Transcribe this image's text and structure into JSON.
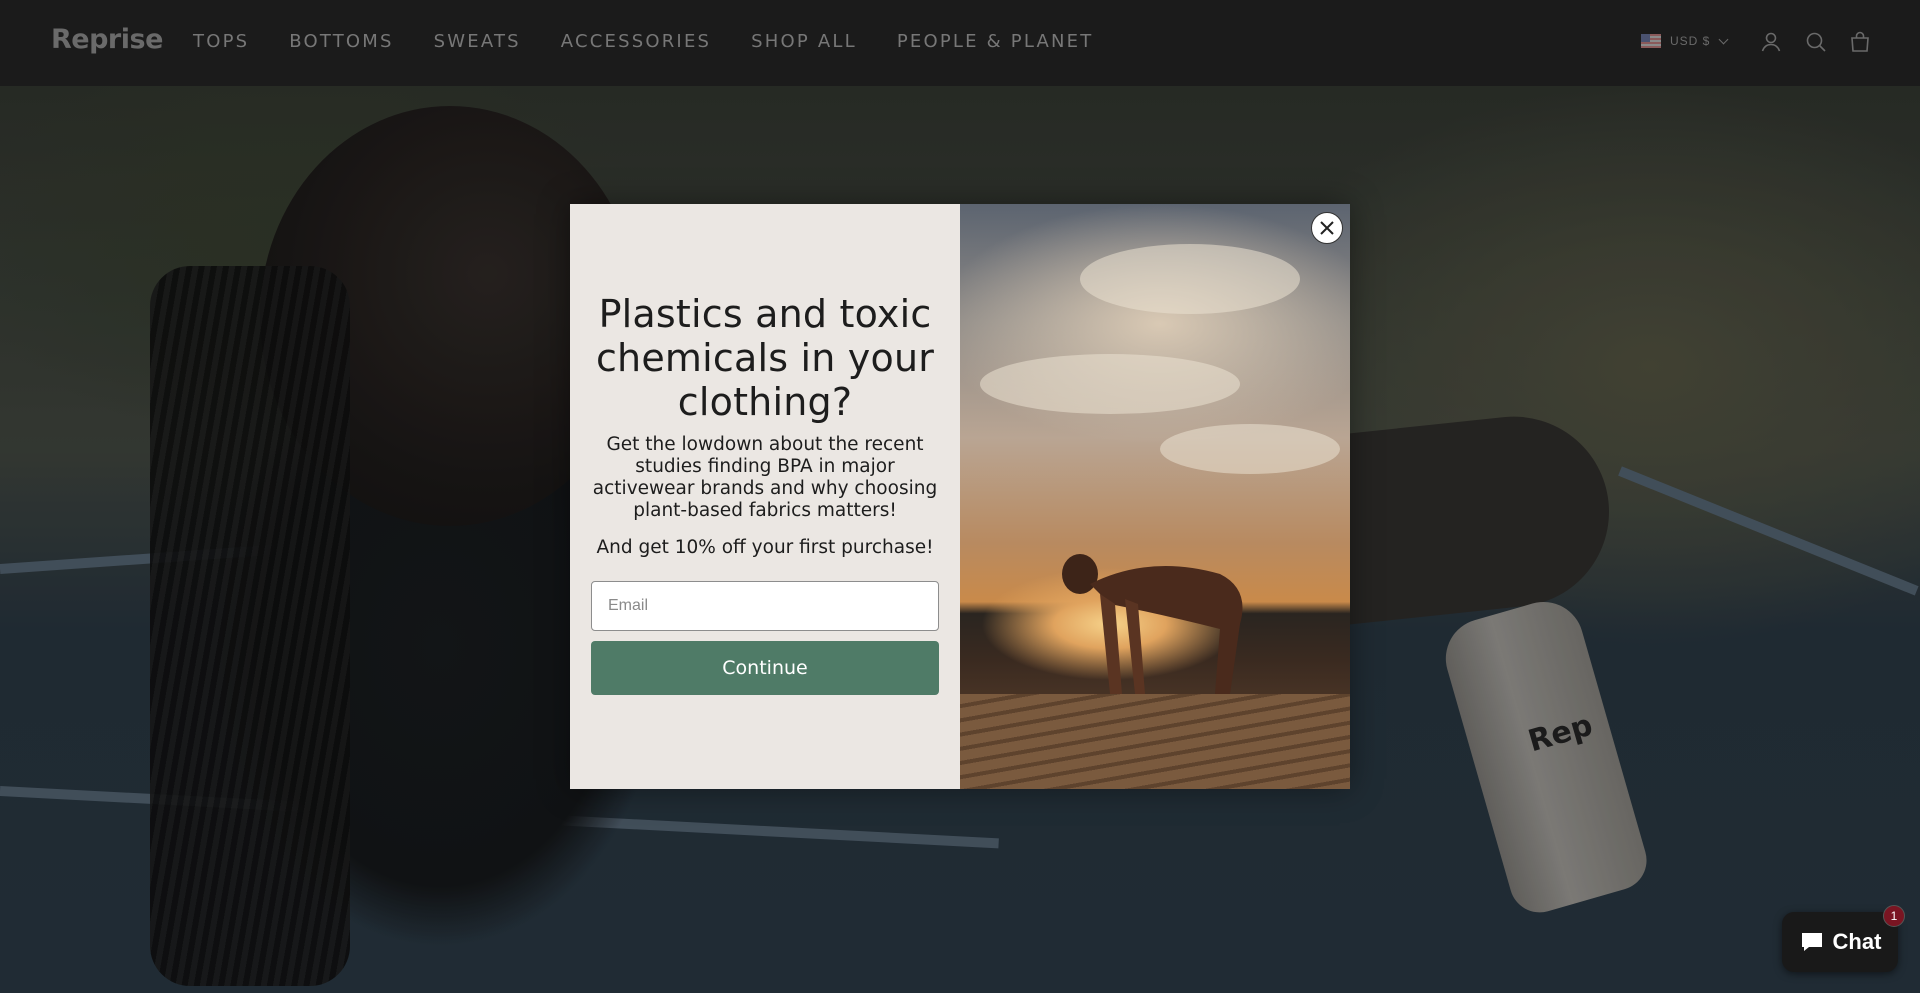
{
  "header": {
    "logo": "Reprise",
    "nav": [
      "TOPS",
      "BOTTOMS",
      "SWEATS",
      "ACCESSORIES",
      "SHOP ALL",
      "PEOPLE & PLANET"
    ],
    "currency": "USD $",
    "icons": [
      "account-icon",
      "search-icon",
      "cart-icon"
    ]
  },
  "hero": {
    "bottle_text": "Rep"
  },
  "modal": {
    "title": "Plastics and toxic chemicals in your clothing?",
    "description": "Get the lowdown about the recent studies finding BPA in major activewear brands and why choosing plant-based fabrics matters!",
    "offer": "And get 10% off your first purchase!",
    "email_placeholder": "Email",
    "email_value": "",
    "continue_label": "Continue",
    "accent": "#4f7b67"
  },
  "chat": {
    "label": "Chat",
    "badge": "1"
  }
}
